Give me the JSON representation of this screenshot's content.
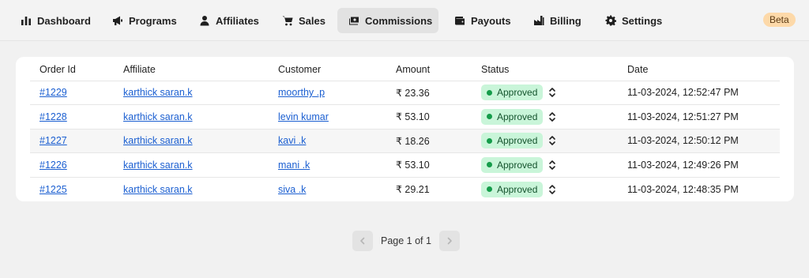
{
  "nav": {
    "items": [
      {
        "label": "Dashboard",
        "icon": "bar-chart-icon"
      },
      {
        "label": "Programs",
        "icon": "megaphone-icon"
      },
      {
        "label": "Affiliates",
        "icon": "user-icon"
      },
      {
        "label": "Sales",
        "icon": "cart-icon"
      },
      {
        "label": "Commissions",
        "icon": "money-icon",
        "active": true
      },
      {
        "label": "Payouts",
        "icon": "wallet-icon"
      },
      {
        "label": "Billing",
        "icon": "factory-icon"
      },
      {
        "label": "Settings",
        "icon": "gear-icon"
      }
    ],
    "badge": "Beta"
  },
  "table": {
    "headers": [
      "Order Id",
      "Affiliate",
      "Customer",
      "Amount",
      "Status",
      "Date"
    ],
    "rows": [
      {
        "order_id": "#1229",
        "affiliate": "karthick saran.k",
        "customer": "moorthy .p",
        "amount": "₹ 23.36",
        "status": "Approved",
        "date": "11-03-2024, 12:52:47 PM"
      },
      {
        "order_id": "#1228",
        "affiliate": "karthick saran.k",
        "customer": "levin kumar",
        "amount": "₹ 53.10",
        "status": "Approved",
        "date": "11-03-2024, 12:51:27 PM"
      },
      {
        "order_id": "#1227",
        "affiliate": "karthick saran.k",
        "customer": "kavi .k",
        "amount": "₹ 18.26",
        "status": "Approved",
        "date": "11-03-2024, 12:50:12 PM"
      },
      {
        "order_id": "#1226",
        "affiliate": "karthick saran.k",
        "customer": "mani .k",
        "amount": "₹ 53.10",
        "status": "Approved",
        "date": "11-03-2024, 12:49:26 PM"
      },
      {
        "order_id": "#1225",
        "affiliate": "karthick saran.k",
        "customer": "siva .k",
        "amount": "₹ 29.21",
        "status": "Approved",
        "date": "11-03-2024, 12:48:35 PM"
      }
    ]
  },
  "pagination": {
    "text": "Page 1 of 1"
  },
  "colors": {
    "accent_link": "#1b5fd1",
    "status_approved_bg": "#c9f5d9",
    "status_approved_dot": "#159c4a",
    "beta_bg": "#fdd9a9"
  }
}
